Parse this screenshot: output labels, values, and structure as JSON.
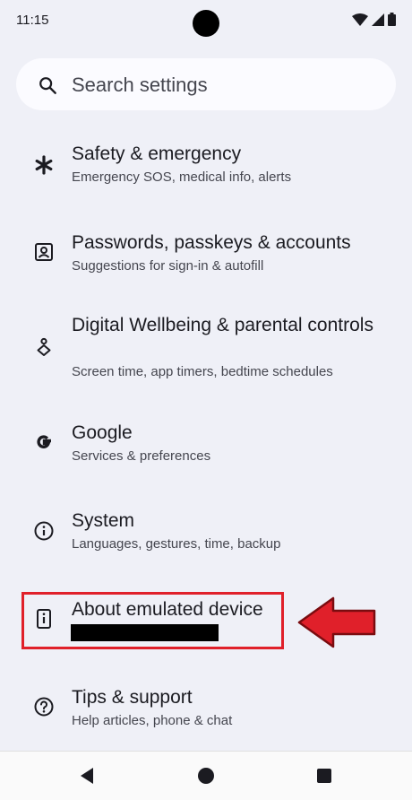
{
  "status": {
    "time": "11:15"
  },
  "search": {
    "placeholder": "Search settings",
    "icon": "search-icon"
  },
  "settings": [
    {
      "key": "safety",
      "icon": "asterisk-icon",
      "title": "Safety & emergency",
      "subtitle": "Emergency SOS, medical info, alerts"
    },
    {
      "key": "passwords",
      "icon": "account-box-icon",
      "title": "Passwords, passkeys & accounts",
      "subtitle": "Suggestions for sign-in & autofill"
    },
    {
      "key": "wellbeing",
      "icon": "wellbeing-icon",
      "title": "Digital Wellbeing & parental controls",
      "subtitle": "Screen time, app timers, bedtime schedules"
    },
    {
      "key": "google",
      "icon": "google-g-icon",
      "title": "Google",
      "subtitle": "Services & preferences"
    },
    {
      "key": "system",
      "icon": "info-icon",
      "title": "System",
      "subtitle": "Languages, gestures, time, backup"
    },
    {
      "key": "about",
      "icon": "device-info-icon",
      "title": "About emulated device",
      "subtitle": ""
    },
    {
      "key": "tips",
      "icon": "help-icon",
      "title": "Tips & support",
      "subtitle": "Help articles, phone & chat"
    }
  ],
  "annotation": {
    "highlight_color": "#e0202a",
    "arrow_color": "#e0202a"
  },
  "nav": {
    "back": "back-icon",
    "home": "home-icon",
    "recents": "recents-icon"
  }
}
